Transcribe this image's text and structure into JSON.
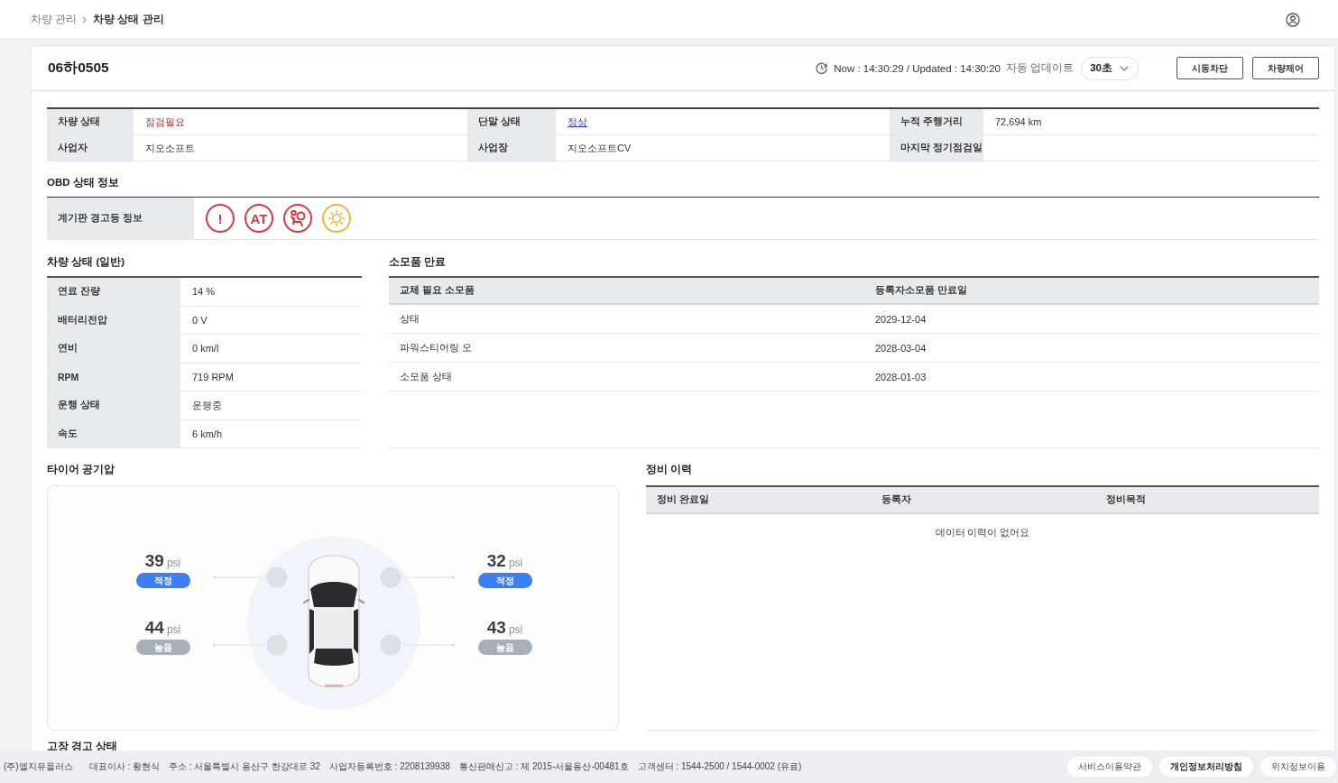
{
  "breadcrumb": [
    {
      "label": "차량 관리",
      "selected": false
    },
    {
      "label": "차량 상태 관리",
      "selected": true
    }
  ],
  "header": {
    "plate": "06하0505",
    "time": "Now : 14:30:29 / Updated : 14:30:20",
    "auto_update_label": "자동 업데이트",
    "interval": "30초",
    "buttons": [
      "시동차단",
      "차량제어"
    ]
  },
  "info": [
    {
      "label": "차량 상태",
      "value": "점검필요",
      "kind": "alert"
    },
    {
      "label": "단말 상태",
      "value": "정상",
      "kind": "link"
    },
    {
      "label": "누적 주행거리",
      "value": "72,694 km",
      "kind": "plain"
    },
    {
      "label": "사업자",
      "value": "지오소프트",
      "kind": "plain"
    },
    {
      "label": "사업장",
      "value": "지오소프트CV",
      "kind": "plain"
    },
    {
      "label": "마지막 정기점검일",
      "kind": "plain"
    }
  ],
  "obd": {
    "title": "OBD 상태 정보",
    "label": "계기판 경고등 정보",
    "warning_lights": [
      {
        "kind": "symbol",
        "label": "!",
        "color": "#d8393f"
      },
      {
        "kind": "symbol",
        "label": "AT",
        "color": "#d8393f"
      },
      {
        "kind": "airbag",
        "color": "#d8393f"
      },
      {
        "kind": "lamp",
        "color": "#f0b43c"
      }
    ]
  },
  "general": {
    "title": "차량 상태 (일반)",
    "rows": [
      {
        "label": "연료 잔량",
        "value": "14 %"
      },
      {
        "label": "배터리전압",
        "value": "0 V"
      },
      {
        "label": "연비",
        "value": "0 km/l"
      },
      {
        "label": "RPM",
        "value": "719 RPM"
      },
      {
        "label": "운행 상태",
        "value": "운행중"
      },
      {
        "label": "속도",
        "value": "6 km/h"
      }
    ]
  },
  "consumables": {
    "title": "소모품 만료",
    "columns": [
      "교체 필요 소모품",
      "등록자소모품 만료일"
    ],
    "rows": [
      [
        "상태",
        "2029-12-04"
      ],
      [
        "파워스티어링 오",
        "2028-03-04"
      ],
      [
        "소모품 상태",
        "2028-01-03"
      ]
    ]
  },
  "tires": {
    "title": "타이어 공기압",
    "items": [
      {
        "value": "39",
        "unit": "psi",
        "status": "적정",
        "color": "#3d7ef5"
      },
      {
        "value": "32",
        "unit": "psi",
        "status": "적정",
        "color": "#3d7ef5"
      },
      {
        "value": "44",
        "unit": "psi",
        "status": "높음",
        "color": "#a7b0ba"
      },
      {
        "value": "43",
        "unit": "psi",
        "status": "높음",
        "color": "#a7b0ba"
      }
    ]
  },
  "maintenance": {
    "title": "정비 이력",
    "columns": [
      "정비 완료일",
      "등록자",
      "정비목적"
    ],
    "empty": "데이터 이력이 없어요"
  },
  "fault_title": "고장 경고 상태",
  "footer": {
    "items": [
      "(주)엘지유플러스",
      "대표이사 : 황현식",
      "주소 : 서울특별시 용산구 한강대로 32",
      "사업자등록번호 : 2208139938",
      "통신판매신고 : 제 2015-서울용산-00481호",
      "고객센터 : 1544-2500 / 1544-0002 (유료)"
    ],
    "links": [
      {
        "label": "서비스이용약관",
        "emphasized": false
      },
      {
        "label": "개인정보처리방침",
        "emphasized": true
      },
      {
        "label": "위치정보이용",
        "emphasized": false
      }
    ]
  }
}
